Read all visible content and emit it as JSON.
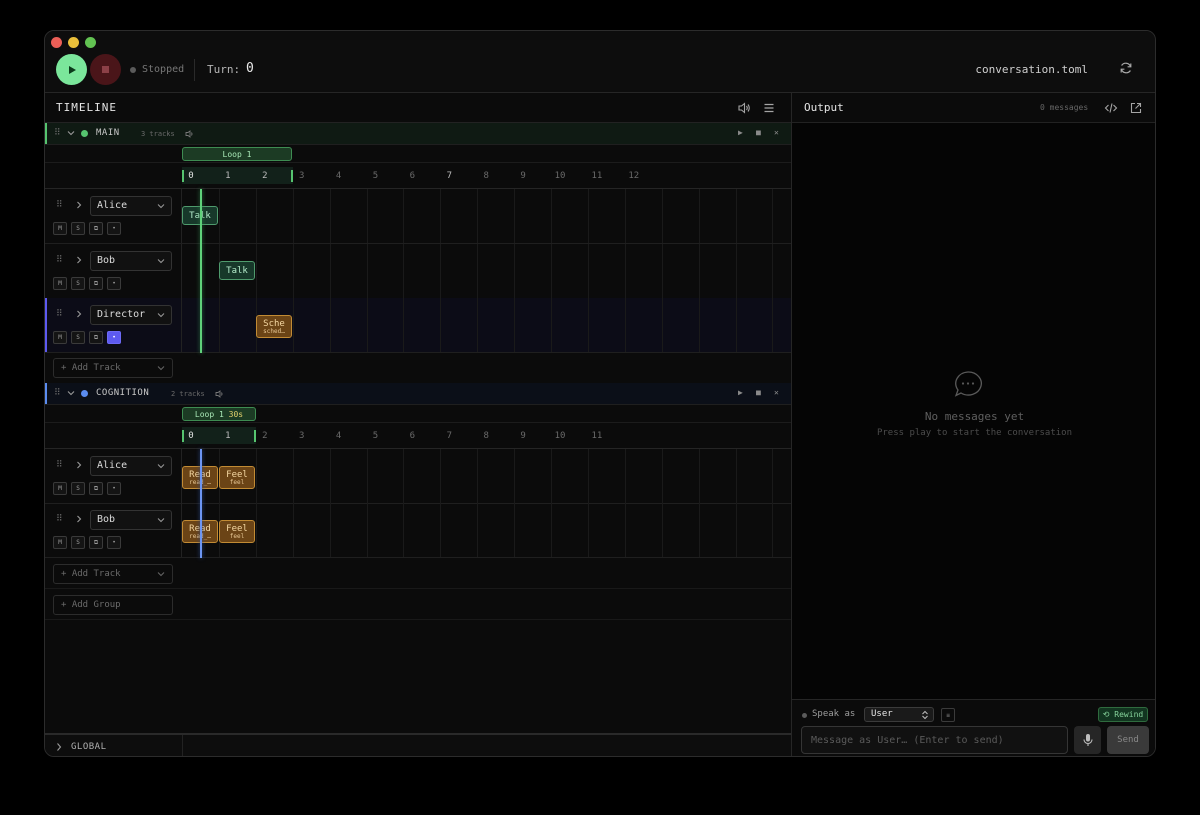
{
  "window": {
    "traffic_lights": [
      "#ec5f57",
      "#e9bf3a",
      "#62c352"
    ]
  },
  "toolbar": {
    "status": "Stopped",
    "turn_label": "Turn:",
    "turn_value": "0",
    "filename": "conversation.toml"
  },
  "timeline": {
    "title": "TIMELINE",
    "groups": [
      {
        "name": "MAIN",
        "count": "3 tracks",
        "color": "#56c46f",
        "loop": {
          "label": "Loop 1",
          "extra": ""
        },
        "ruler": [
          "0",
          "1",
          "2",
          "3",
          "4",
          "5",
          "6",
          "7",
          "8",
          "9",
          "10",
          "11",
          "12"
        ],
        "tracks": [
          {
            "name": "Alice",
            "clips": [
              {
                "label": "Talk",
                "sub": ""
              }
            ]
          },
          {
            "name": "Bob",
            "clips": [
              {
                "label": "Talk",
                "sub": ""
              }
            ]
          },
          {
            "name": "Director",
            "clips": [
              {
                "label": "Sche",
                "sub": "sched…"
              }
            ]
          }
        ]
      },
      {
        "name": "COGNITION",
        "count": "2 tracks",
        "color": "#5b8cf0",
        "loop": {
          "label": "Loop 1",
          "extra": "30s"
        },
        "ruler": [
          "0",
          "1",
          "2",
          "3",
          "4",
          "5",
          "6",
          "7",
          "8",
          "9",
          "10",
          "11"
        ],
        "tracks": [
          {
            "name": "Alice",
            "clips": [
              {
                "label": "Read",
                "sub": "read_…"
              },
              {
                "label": "Feel",
                "sub": "feel"
              }
            ]
          },
          {
            "name": "Bob",
            "clips": [
              {
                "label": "Read",
                "sub": "read_…"
              },
              {
                "label": "Feel",
                "sub": "feel"
              }
            ]
          }
        ]
      }
    ],
    "track_buttons": [
      "M",
      "S",
      "⧉",
      "•"
    ],
    "add_track": "+ Add Track",
    "add_group": "+ Add Group",
    "global": "GLOBAL"
  },
  "output": {
    "title": "Output",
    "count": "0 messages",
    "empty_title": "No messages yet",
    "empty_subtitle": "Press play to start the conversation",
    "speak_label": "Speak as",
    "speak_value": "User",
    "rewind": "⟲ Rewind",
    "placeholder": "Message as User… (Enter to send)",
    "send": "Send"
  }
}
